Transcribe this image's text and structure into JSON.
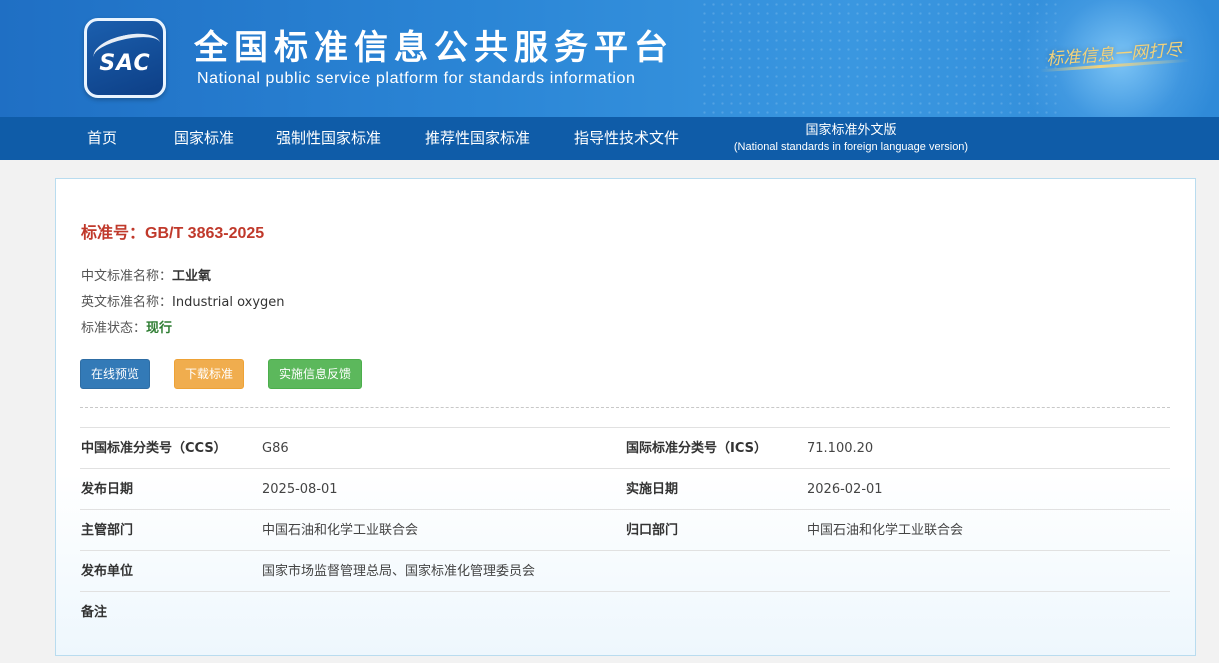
{
  "header": {
    "logo_text": "SAC",
    "title_cn": "全国标准信息公共服务平台",
    "title_en": "National public service platform  for standards information",
    "slogan": "标准信息一网打尽"
  },
  "nav": {
    "items": [
      "首页",
      "国家标准",
      "强制性国家标准",
      "推荐性国家标准",
      "指导性技术文件"
    ],
    "foreign": {
      "line1": "国家标准外文版",
      "line2": "(National standards in foreign language version)"
    }
  },
  "standard": {
    "number_label": "标准号：",
    "number": "GB/T 3863-2025",
    "cn_name_label": "中文标准名称：",
    "cn_name": "工业氧",
    "en_name_label": "英文标准名称：",
    "en_name": "Industrial oxygen",
    "status_label": "标准状态：",
    "status": "现行"
  },
  "buttons": {
    "preview": "在线预览",
    "download": "下载标准",
    "feedback": "实施信息反馈"
  },
  "details": [
    {
      "k1": "中国标准分类号（CCS）",
      "v1": "G86",
      "k2": "国际标准分类号（ICS）",
      "v2": "71.100.20"
    },
    {
      "k1": "发布日期",
      "v1": "2025-08-01",
      "k2": "实施日期",
      "v2": "2026-02-01"
    },
    {
      "k1": "主管部门",
      "v1": "中国石油和化学工业联合会",
      "k2": "归口部门",
      "v2": "中国石油和化学工业联合会"
    },
    {
      "k1": "发布单位",
      "v1": "国家市场监督管理总局、国家标准化管理委员会",
      "k2": "",
      "v2": ""
    },
    {
      "k1": "备注",
      "v1": "",
      "k2": "",
      "v2": ""
    }
  ],
  "colors": {
    "nav_bg": "#0f5ca8",
    "title_red": "#c0392b",
    "status_green": "#2e7d32"
  }
}
